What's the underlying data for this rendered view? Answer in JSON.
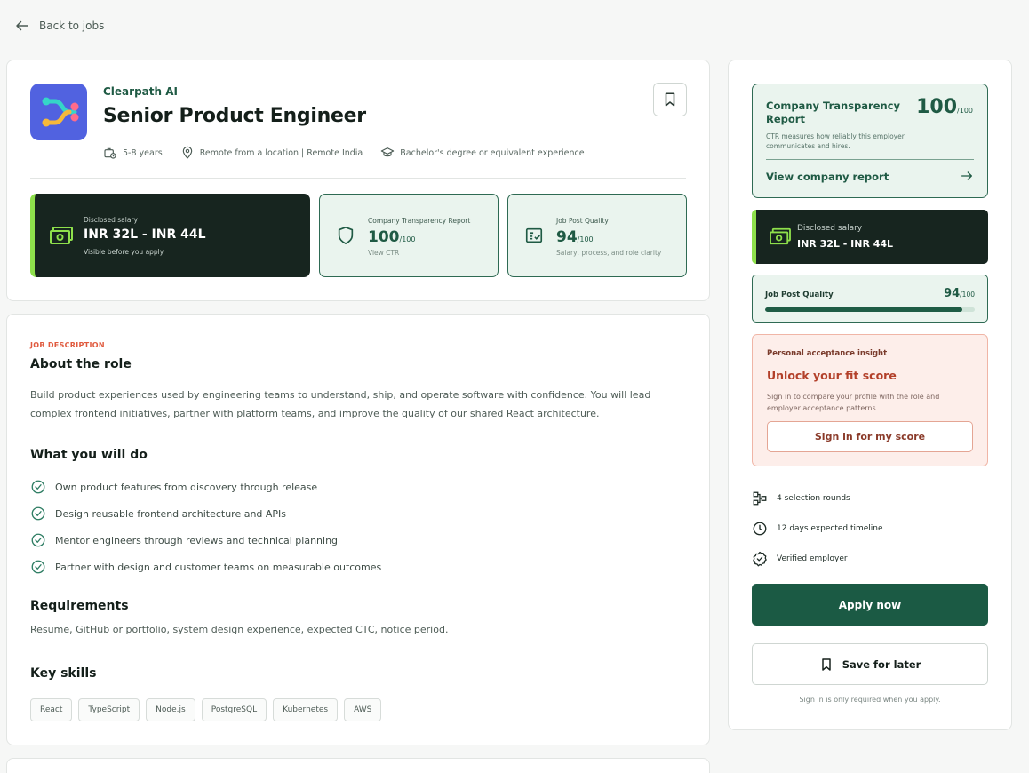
{
  "nav": {
    "back_label": "Back to jobs"
  },
  "job": {
    "company": "Clearpath AI",
    "title": "Senior Product Engineer",
    "meta": {
      "experience": "5-8 years",
      "location": "Remote from a location | Remote India",
      "education": "Bachelor's degree or equivalent experience"
    }
  },
  "tiles": {
    "salary": {
      "label": "Disclosed salary",
      "value": "INR 32L - INR 44L",
      "sub": "Visible before you apply"
    },
    "ctr": {
      "label": "Company Transparency Report",
      "score": "100",
      "max": "/100",
      "sub": "View CTR"
    },
    "jpq": {
      "label": "Job Post Quality",
      "score": "94",
      "max": "/100",
      "sub": "Salary, process, and role clarity"
    }
  },
  "description": {
    "eyebrow": "JOB DESCRIPTION",
    "about_heading": "About the role",
    "about_text": "Build product experiences used by engineering teams to understand, ship, and operate software with confidence. You will lead complex frontend initiatives, partner with platform teams, and improve the quality of our shared React architecture.",
    "todo_heading": "What you will do",
    "todo_items": [
      "Own product features from discovery through release",
      "Design reusable frontend architecture and APIs",
      "Mentor engineers through reviews and technical planning",
      "Partner with design and customer teams on measurable outcomes"
    ],
    "req_heading": "Requirements",
    "req_text": "Resume, GitHub or portfolio, system design experience, expected CTC, notice period.",
    "skills_heading": "Key skills",
    "skills": [
      "React",
      "TypeScript",
      "Node.js",
      "PostgreSQL",
      "Kubernetes",
      "AWS"
    ]
  },
  "sidebar": {
    "ctr": {
      "title": "Company Transparency Report",
      "score": "100",
      "max": "/100",
      "desc": "CTR measures how reliably this employer communicates and hires.",
      "link": "View company report"
    },
    "salary": {
      "label": "Disclosed salary",
      "value": "INR 32L - INR 44L"
    },
    "jpq": {
      "label": "Job Post Quality",
      "score": "94",
      "max": "/100",
      "progress_pct": 94
    },
    "fit": {
      "label": "Personal acceptance insight",
      "title": "Unlock your fit score",
      "desc": "Sign in to compare your profile with the role and employer acceptance patterns.",
      "button": "Sign in for my score"
    },
    "facts": {
      "rounds": "4 selection rounds",
      "timeline": "12 days expected timeline",
      "verified": "Verified employer"
    },
    "apply_label": "Apply now",
    "save_label": "Save for later",
    "note": "Sign in is only required when you apply."
  },
  "colors": {
    "brand_green": "#1b5a44",
    "accent_lime": "#8ee04b",
    "dark_tile": "#17251f",
    "warning_red": "#b3402a",
    "logo_blue": "#5162e0"
  }
}
